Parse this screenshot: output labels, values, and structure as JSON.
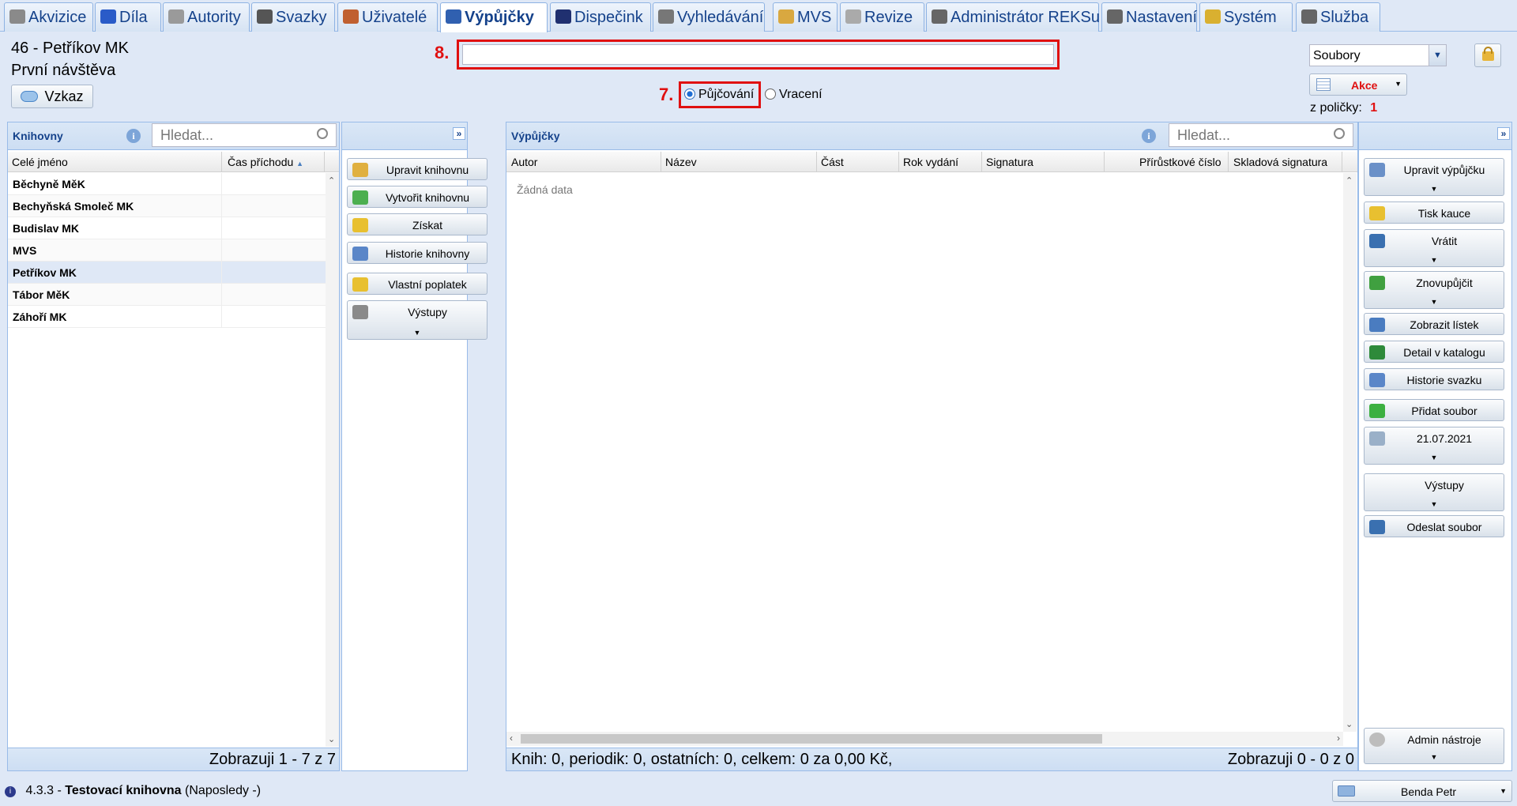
{
  "tabs": [
    {
      "label": "Akvizice",
      "icon": "cart-icon"
    },
    {
      "label": "Díla",
      "icon": "book-icon"
    },
    {
      "label": "Autority",
      "icon": "card-icon"
    },
    {
      "label": "Svazky",
      "icon": "pen-icon"
    },
    {
      "label": "Uživatelé",
      "icon": "users-icon"
    },
    {
      "label": "Výpůjčky",
      "icon": "books-icon"
    },
    {
      "label": "Dispečink",
      "icon": "monitor-icon"
    },
    {
      "label": "Vyhledávání",
      "icon": "safe-icon"
    },
    {
      "label": "MVS",
      "icon": "box-icon"
    },
    {
      "label": "Revize",
      "icon": "document-icon"
    },
    {
      "label": "Administrátor REKSu",
      "icon": "tools-icon"
    },
    {
      "label": "Nastavení",
      "icon": "tools-icon"
    },
    {
      "label": "Systém",
      "icon": "key-icon"
    },
    {
      "label": "Služba",
      "icon": "tools-icon"
    }
  ],
  "header": {
    "patron_line1": "46 - Petříkov MK",
    "patron_line2": "První návštěva",
    "message_button": "Vzkaz",
    "annotation_8": "8.",
    "annotation_7": "7.",
    "barcode_input_value": "",
    "radio_lend": "Půjčování",
    "radio_return": "Vracení",
    "files_select": "Soubory",
    "actions_button": "Akce",
    "shelf_label": "z poličky:",
    "shelf_count": "1"
  },
  "libraries_panel": {
    "title": "Knihovny",
    "search_placeholder": "Hledat...",
    "col_name": "Celé jméno",
    "col_time": "Čas příchodu",
    "rows": [
      "Běchyně MěK",
      "Bechyňská Smoleč MK",
      "Budislav MK",
      "MVS",
      "Petříkov MK",
      "Tábor MěK",
      "Záhoří MK"
    ],
    "footer": "Zobrazuji 1 - 7 z 7"
  },
  "library_actions": [
    {
      "label": "Upravit knihovnu",
      "icon": "pencil-icon"
    },
    {
      "label": "Vytvořit knihovnu",
      "icon": "plus-circle-icon"
    },
    {
      "label": "Získat",
      "icon": "coins-icon"
    },
    {
      "label": "Historie knihovny",
      "icon": "info-icon"
    },
    {
      "label": "Vlastní poplatek",
      "icon": "coins-icon"
    },
    {
      "label": "Výstupy",
      "icon": "printer-icon"
    }
  ],
  "loans_panel": {
    "title": "Výpůjčky",
    "search_placeholder": "Hledat...",
    "columns": [
      "Autor",
      "Název",
      "Část",
      "Rok vydání",
      "Signatura",
      "Přírůstkové číslo",
      "Skladová signatura"
    ],
    "empty": "Žádná data",
    "footer_left": "Knih: 0, periodik: 0, ostatních: 0, celkem: 0 za 0,00 Kč,",
    "footer_right": "Zobrazuji 0 - 0 z 0"
  },
  "loan_actions": [
    {
      "label": "Upravit výpůjčku",
      "icon": "edit-icon"
    },
    {
      "label": "Tisk kauce",
      "icon": "coins-icon"
    },
    {
      "label": "Vrátit",
      "icon": "return-icon"
    },
    {
      "label": "Znovupůjčit",
      "icon": "refresh-icon"
    },
    {
      "label": "Zobrazit lístek",
      "icon": "ticket-icon"
    },
    {
      "label": "Detail v katalogu",
      "icon": "globe-icon"
    },
    {
      "label": "Historie svazku",
      "icon": "info-icon"
    },
    {
      "label": "Přidat soubor",
      "icon": "plus-icon"
    },
    {
      "label": "21.07.2021",
      "icon": "magnifier-icon"
    },
    {
      "label": "Výstupy",
      "icon": ""
    },
    {
      "label": "Odeslat soubor",
      "icon": "send-icon"
    }
  ],
  "admin_tools": "Admin nástroje",
  "status": {
    "version": "4.3.3 -",
    "library": "Testovací knihovna",
    "last": "(Naposledy -)",
    "user": "Benda Petr"
  }
}
